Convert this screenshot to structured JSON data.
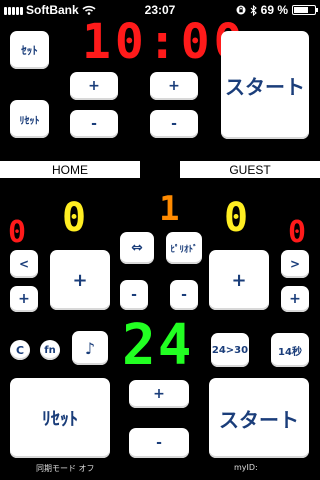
{
  "status_bar": {
    "carrier": "SoftBank",
    "time": "23:07",
    "battery_percent": "69 %",
    "battery_level": 0.69
  },
  "game_clock": {
    "display": "10:00",
    "set_label": "ｾｯﾄ",
    "reset_label": "ﾘｾｯﾄ",
    "min_plus_label": "+",
    "min_minus_label": "-",
    "sec_plus_label": "+",
    "sec_minus_label": "-",
    "start_label": "スタート"
  },
  "teams": {
    "home_label": "HOME",
    "guest_label": "GUEST"
  },
  "scoreboard": {
    "home_fouls": "0",
    "home_score": "0",
    "period": "1",
    "guest_score": "0",
    "guest_fouls": "0",
    "home_foul_down_label": "<",
    "home_foul_up_label": "+",
    "home_score_up_label": "+",
    "home_score_down_label": "-",
    "swap_label": "⇔",
    "period_label": "ﾋﾟﾘｵﾄﾞ",
    "period_down_label": "-",
    "guest_score_up_label": "+",
    "guest_score_down_label": "-",
    "guest_foul_down_label": ">",
    "guest_foul_up_label": "+"
  },
  "shot_clock": {
    "display": "24",
    "clear_label": "C",
    "fn_label": "fn",
    "horn_label": "♪",
    "mode_label": "24>30",
    "fourteen_label": "14秒",
    "plus_label": "+",
    "minus_label": "-",
    "reset_label": "ﾘｾｯﾄ",
    "start_label": "スタート"
  },
  "footer": {
    "sync_mode": "同期モード オフ",
    "my_id": "myID:"
  },
  "colors": {
    "clock": "#ff1a1a",
    "score": "#ffee22",
    "period": "#ff8a00",
    "shot_clock": "#22ff22",
    "button_text": "#1a3d7a"
  }
}
